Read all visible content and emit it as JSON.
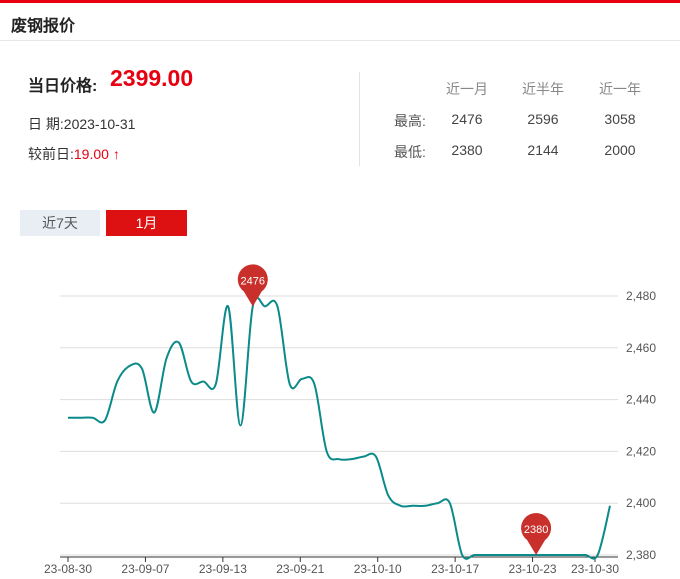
{
  "header": {
    "title": "废钢报价"
  },
  "summary": {
    "price_label": "当日价格:",
    "price_value": "2399.00",
    "date_label": "日 期:",
    "date_value": "2023-10-31",
    "change_label": "较前日:",
    "change_value": "19.00",
    "change_arrow": "↑"
  },
  "stats": {
    "columns": [
      "近一月",
      "近半年",
      "近一年"
    ],
    "rows": [
      {
        "label": "最高:",
        "values": [
          "2476",
          "2596",
          "3058"
        ]
      },
      {
        "label": "最低:",
        "values": [
          "2380",
          "2144",
          "2000"
        ]
      }
    ]
  },
  "tabs": [
    {
      "label": "近7天",
      "active": false
    },
    {
      "label": "1月",
      "active": true
    }
  ],
  "colors": {
    "accent": "#e60012",
    "line": "#0b8a8a",
    "marker": "#c9302c",
    "grid": "#dddddd"
  },
  "chart_data": {
    "type": "line",
    "x_tick_labels": [
      "23-08-30",
      "23-09-07",
      "23-09-13",
      "23-09-21",
      "23-10-10",
      "23-10-17",
      "23-10-23",
      "23-10-30"
    ],
    "y_tick_labels": [
      "2,480",
      "2,460",
      "2,440",
      "2,420",
      "2,400",
      "2,380"
    ],
    "ylim": [
      2380,
      2480
    ],
    "y_axis_position": "right",
    "grid": "horizontal",
    "x": [
      "08-30",
      "08-31",
      "09-01",
      "09-03",
      "09-04",
      "09-05",
      "09-06",
      "09-07",
      "09-08",
      "09-09",
      "09-11",
      "09-12",
      "09-13",
      "09-14",
      "09-15",
      "09-16",
      "09-17",
      "09-18",
      "09-19",
      "09-20",
      "09-21",
      "09-22",
      "09-23",
      "09-24",
      "09-25",
      "09-26",
      "09-27",
      "10-08",
      "10-09",
      "10-10",
      "10-11",
      "10-12",
      "10-13",
      "10-16",
      "10-17",
      "10-18",
      "10-19",
      "10-20",
      "10-23",
      "10-24",
      "10-25",
      "10-26",
      "10-27",
      "10-30",
      "10-31"
    ],
    "values": [
      2433,
      2433,
      2433,
      2432,
      2447,
      2453,
      2452,
      2435,
      2456,
      2462,
      2447,
      2447,
      2446,
      2476,
      2430,
      2476,
      2476,
      2476,
      2446,
      2448,
      2446,
      2420,
      2417,
      2417,
      2418,
      2418,
      2403,
      2399,
      2399,
      2399,
      2400,
      2400,
      2380,
      2380,
      2380,
      2380,
      2380,
      2380,
      2380,
      2380,
      2380,
      2380,
      2380,
      2380,
      2399
    ],
    "markers": [
      {
        "label": "2476",
        "x": "09-16",
        "value": 2476
      },
      {
        "label": "2380",
        "x": "10-23",
        "value": 2380
      }
    ]
  }
}
